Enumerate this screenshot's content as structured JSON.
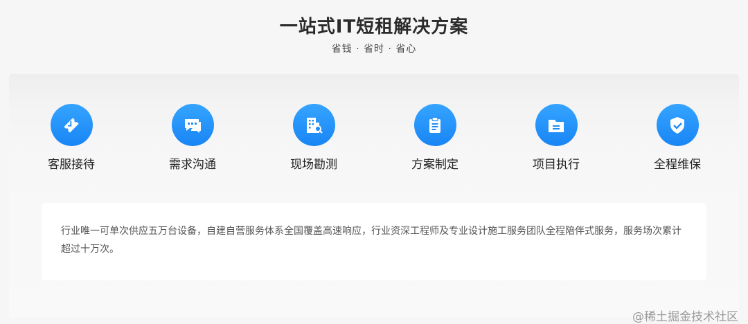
{
  "header": {
    "title": "一站式IT短租解决方案",
    "subtitle": "省钱 · 省时 · 省心"
  },
  "steps": [
    {
      "label": "客服接待",
      "icon": "ticket-icon"
    },
    {
      "label": "需求沟通",
      "icon": "chat-icon"
    },
    {
      "label": "现场勘测",
      "icon": "building-search-icon"
    },
    {
      "label": "方案制定",
      "icon": "clipboard-icon"
    },
    {
      "label": "项目执行",
      "icon": "folder-icon"
    },
    {
      "label": "全程维保",
      "icon": "shield-check-icon"
    }
  ],
  "description": "行业唯一可单次供应五万台设备，自建自营服务体系全国覆盖高速响应，行业资深工程师及专业设计施工服务团队全程陪伴式服务，服务场次累计超过十万次。",
  "watermark": "@稀土掘金技术社区",
  "colors": {
    "accent": "#1d8bf8",
    "title": "#2b2b2b",
    "text": "#555555"
  }
}
